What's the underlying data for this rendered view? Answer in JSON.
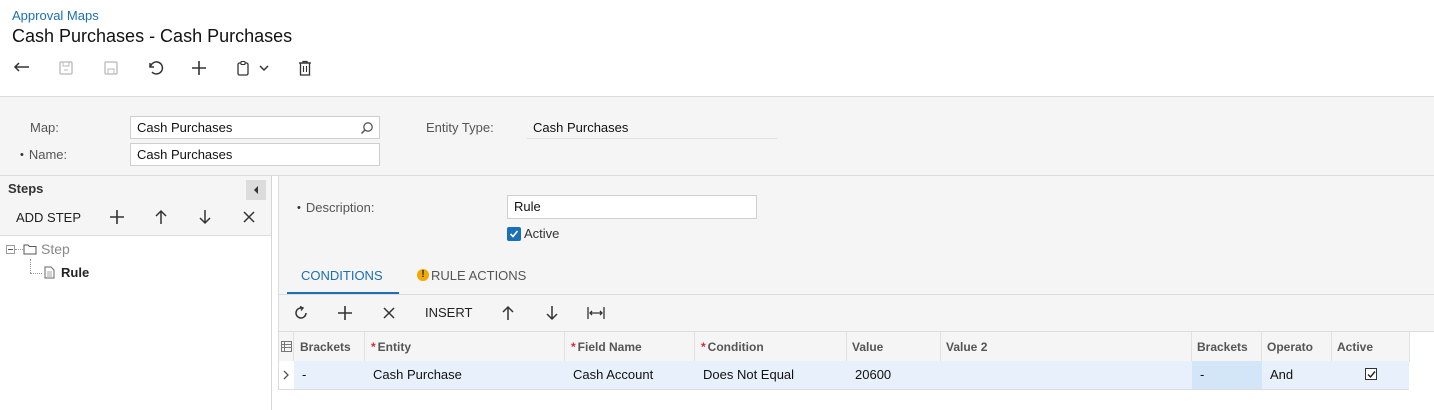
{
  "breadcrumb": "Approval Maps",
  "page_title": "Cash Purchases - Cash Purchases",
  "toolbar": {
    "icons": [
      "back-icon",
      "save-close-icon",
      "save-icon",
      "undo-icon",
      "add-icon",
      "copy-paste-icon",
      "chevron-down-icon",
      "delete-icon"
    ]
  },
  "form": {
    "map_label": "Map:",
    "map_value": "Cash Purchases",
    "name_label": "Name:",
    "name_value": "Cash Purchases",
    "entity_type_label": "Entity Type:",
    "entity_type_value": "Cash Purchases"
  },
  "steps": {
    "title": "Steps",
    "add_step_label": "ADD STEP",
    "tree": {
      "step_label": "Step",
      "rule_label": "Rule"
    }
  },
  "rule": {
    "description_label": "Description:",
    "description_value": "Rule",
    "active_label": "Active",
    "active_checked": true
  },
  "tabs": [
    {
      "label": "CONDITIONS",
      "active": true
    },
    {
      "label": "RULE ACTIONS",
      "active": false,
      "warning": true
    }
  ],
  "grid_toolbar": {
    "insert_label": "INSERT"
  },
  "grid": {
    "headers": {
      "brackets_open": "Brackets",
      "entity": "Entity",
      "field_name": "Field Name",
      "condition": "Condition",
      "value": "Value",
      "value2": "Value 2",
      "brackets_close": "Brackets",
      "operator": "Operato",
      "active": "Active"
    },
    "rows": [
      {
        "brackets_open": "-",
        "entity": "Cash Purchase",
        "field_name": "Cash Account",
        "condition": "Does Not Equal",
        "value": "20600",
        "value2": "",
        "brackets_close": "-",
        "operator": "And",
        "active": true
      }
    ]
  },
  "colors": {
    "accent": "#1a6fb5",
    "selected_row": "#e8f1fb",
    "selected_cell": "#d3e6f7",
    "warning": "#f2a900"
  }
}
